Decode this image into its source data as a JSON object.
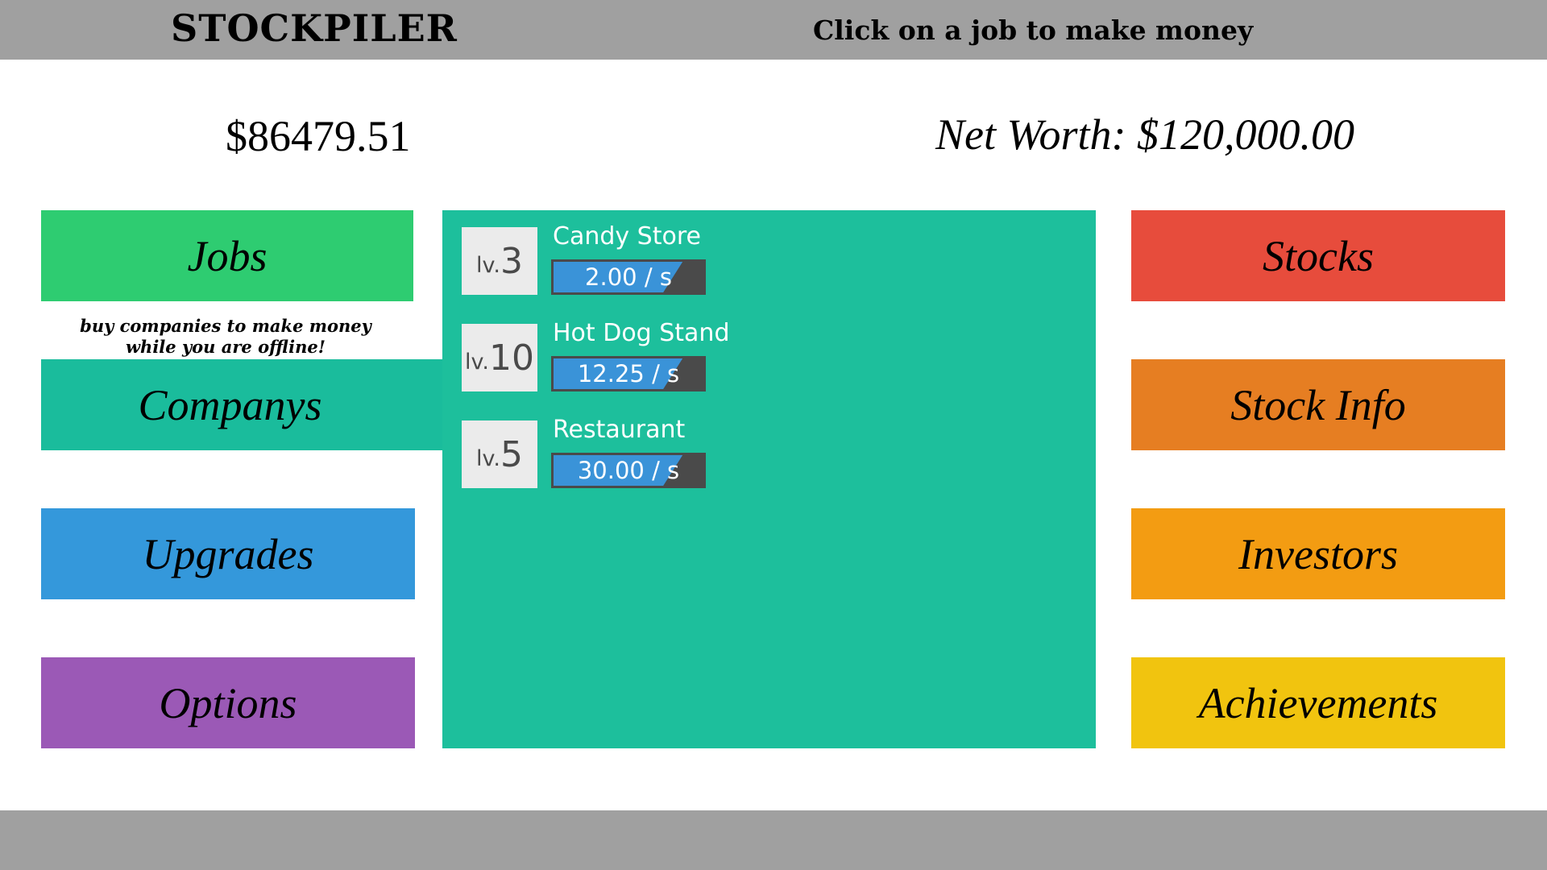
{
  "header": {
    "title": "STOCKPILER",
    "hint": "Click on a job to make money"
  },
  "stats": {
    "money": "$86479.51",
    "net_worth": "Net Worth: $120,000.00"
  },
  "left_menu": {
    "jobs": "Jobs",
    "companies_note_line1": "buy companies to make money",
    "companies_note_line2": "while you are offline!",
    "companies": "Companys",
    "upgrades": "Upgrades",
    "options": "Options"
  },
  "right_menu": {
    "stocks": "Stocks",
    "stock_info": "Stock Info",
    "investors": "Investors",
    "achievements": "Achievements"
  },
  "companies": [
    {
      "level_prefix": "lv.",
      "level": "3",
      "name": "Candy Store",
      "rate": "2.00 / s",
      "progress": 0.85
    },
    {
      "level_prefix": "lv.",
      "level": "10",
      "name": "Hot Dog Stand",
      "rate": "12.25 / s",
      "progress": 0.85
    },
    {
      "level_prefix": "lv.",
      "level": "5",
      "name": "Restaurant",
      "rate": "30.00 / s",
      "progress": 0.85
    }
  ],
  "colors": {
    "jobs": "#2ecc71",
    "companys": "#1abc9c",
    "upgrades": "#3498db",
    "options": "#9b59b6",
    "stocks": "#e74c3c",
    "stock_info": "#e67e22",
    "investors": "#f39c12",
    "achievements": "#f1c40f",
    "bars": "#a0a0a0"
  }
}
